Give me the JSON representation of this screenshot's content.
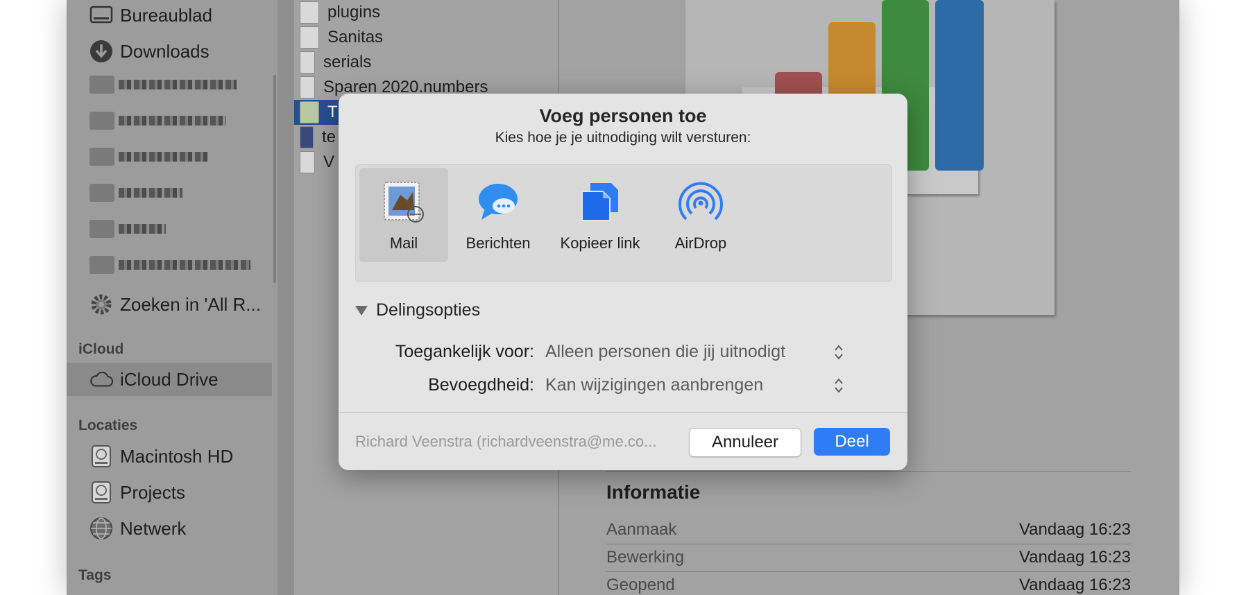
{
  "sidebar": {
    "favorites": [
      {
        "label": "Bureaublad",
        "icon": "desktop-icon"
      },
      {
        "label": "Downloads",
        "icon": "download-icon"
      }
    ],
    "search_item": {
      "label": "Zoeken in 'All R...",
      "icon": "gear-icon"
    },
    "icloud_header": "iCloud",
    "icloud_drive": {
      "label": "iCloud Drive",
      "icon": "cloud-icon"
    },
    "locations_header": "Locaties",
    "locations": [
      {
        "label": "Macintosh HD",
        "icon": "disk-icon"
      },
      {
        "label": "Projects",
        "icon": "disk-icon"
      },
      {
        "label": "Netwerk",
        "icon": "globe-icon"
      }
    ],
    "tags_header": "Tags"
  },
  "files": [
    {
      "name": "plugins"
    },
    {
      "name": "Sanitas"
    },
    {
      "name": "serials"
    },
    {
      "name": "Sparen 2020.numbers"
    },
    {
      "name": "T"
    },
    {
      "name": "te"
    },
    {
      "name": "V"
    }
  ],
  "preview": {
    "info_title": "Informatie",
    "rows": [
      {
        "key": "Aanmaak",
        "value": "Vandaag 16:23"
      },
      {
        "key": "Bewerking",
        "value": "Vandaag 16:23"
      },
      {
        "key": "Geopend",
        "value": "Vandaag 16:23"
      }
    ]
  },
  "dialog": {
    "title": "Voeg personen toe",
    "subtitle": "Kies hoe je je uitnodiging wilt versturen:",
    "methods": [
      {
        "label": "Mail",
        "icon": "mail-icon",
        "selected": true
      },
      {
        "label": "Berichten",
        "icon": "messages-icon",
        "selected": false
      },
      {
        "label": "Kopieer link",
        "icon": "copy-link-icon",
        "selected": false
      },
      {
        "label": "AirDrop",
        "icon": "airdrop-icon",
        "selected": false
      }
    ],
    "options_header": "Delingsopties",
    "access_label": "Toegankelijk voor:",
    "access_value": "Alleen personen die jij uitnodigt",
    "permission_label": "Bevoegdheid:",
    "permission_value": "Kan wijzigingen aanbrengen",
    "account": "Richard Veenstra (richardveenstra@me.co...",
    "cancel_label": "Annuleer",
    "share_label": "Deel"
  },
  "colors": {
    "accent": "#2f7cf6",
    "selection": "#27508f"
  }
}
